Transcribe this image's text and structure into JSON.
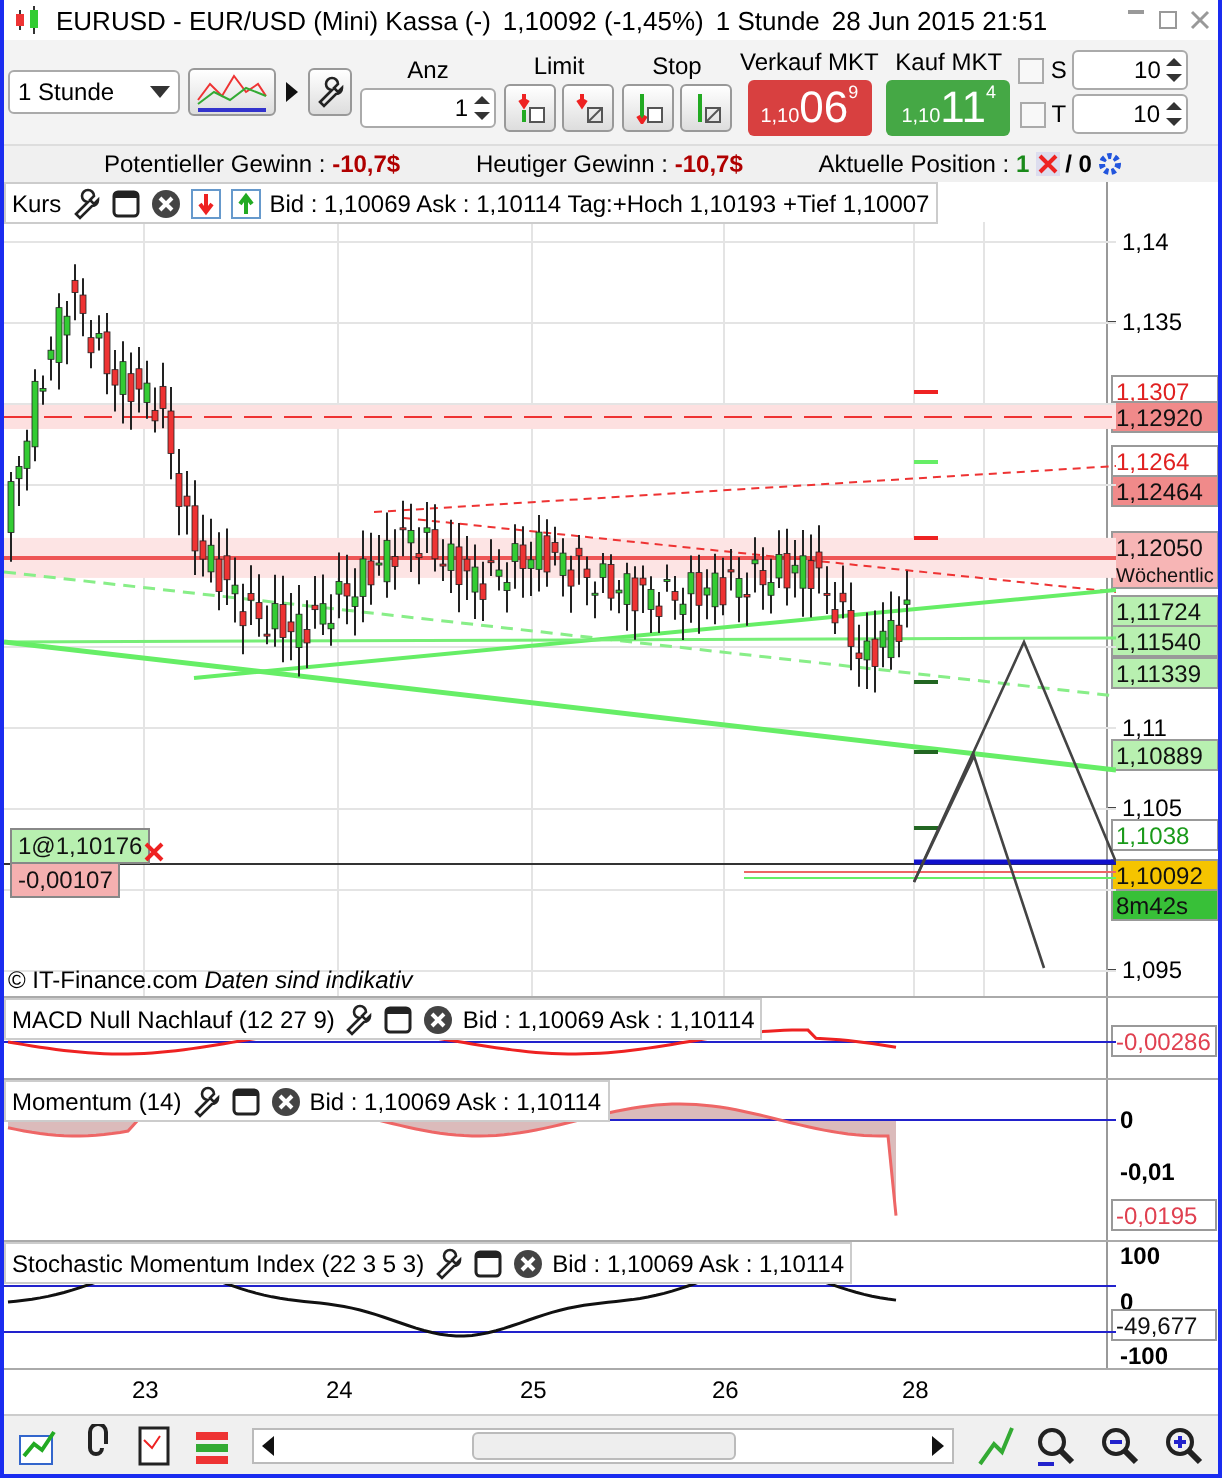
{
  "window": {
    "symbol": "EURUSD - EUR/USD (Mini) Kassa (-)",
    "quote": "1,10092 (-1,45%)",
    "interval": "1 Stunde",
    "datetime": "28 Jun 2015 21:51"
  },
  "toolbar": {
    "timeframe": "1 Stunde",
    "amount": {
      "label": "Anz",
      "value": "1"
    },
    "limit_label": "Limit",
    "stop_label": "Stop",
    "sell": {
      "label": "Verkauf MKT",
      "prefix": "1,10",
      "big": "06",
      "sup": "9"
    },
    "buy": {
      "label": "Kauf MKT",
      "prefix": "1,10",
      "big": "11",
      "sup": "4"
    },
    "stops": [
      {
        "label": "S",
        "checked": false,
        "value": "10"
      },
      {
        "label": "T",
        "checked": false,
        "value": "10"
      }
    ]
  },
  "info": {
    "items": [
      {
        "label": "Potentieller Gewinn :",
        "value": "-10,7$"
      },
      {
        "label": "Heutiger Gewinn :",
        "value": "-10,7$"
      }
    ],
    "position": {
      "label": "Aktuelle Position :",
      "count": "1",
      "rest": "/ 0"
    }
  },
  "main_chart": {
    "title": "Kurs",
    "quote": "Bid : 1,10069 Ask : 1,10114 Tag:+Hoch 1,10193 +Tief 1,10007",
    "yticks": [
      "1,14",
      "1,135",
      "1,11",
      "1,105",
      "1,095"
    ],
    "price_tags": [
      {
        "text": "1,1307",
        "kind": "outline-red"
      },
      {
        "text": "1,12920",
        "kind": "fill-red"
      },
      {
        "text": "1,1264",
        "kind": "outline-red"
      },
      {
        "text": "1,12464",
        "kind": "fill-red"
      },
      {
        "text": "1,12050",
        "note": "Wöchentlic",
        "kind": "weekly"
      },
      {
        "text": "1,11724",
        "kind": "fill-green"
      },
      {
        "text": "1,11540",
        "kind": "fill-green"
      },
      {
        "text": "1,11339",
        "kind": "fill-green"
      },
      {
        "text": "1,10889",
        "kind": "fill-green"
      },
      {
        "text": "1,1038",
        "kind": "outline-green"
      },
      {
        "text": "1,10092",
        "kind": "current"
      },
      {
        "text": "8m42s",
        "kind": "timer"
      }
    ],
    "position_tag": "1@1,10176",
    "pl_tag": "-0,00107",
    "footer": "© IT-Finance.com",
    "footer_note": "Daten sind indikativ"
  },
  "indicators": [
    {
      "kind": "macd",
      "title": "MACD Null Nachlauf (12 27 9)",
      "quote": "Bid : 1,10069 Ask : 1,10114",
      "tag": "-0,00286"
    },
    {
      "kind": "momentum",
      "title": "Momentum (14)",
      "quote": "Bid : 1,10069 Ask : 1,10114",
      "yticks": [
        "0",
        "-0,01"
      ],
      "tag": "-0,0195"
    },
    {
      "kind": "stochastic",
      "title": "Stochastic Momentum Index (22 3 5 3)",
      "quote": "Bid : 1,10069 Ask : 1,10114",
      "yticks": [
        "100",
        "0",
        "-100"
      ],
      "tag": "-49,677"
    }
  ],
  "xaxis": [
    "23",
    "24",
    "25",
    "26",
    "28"
  ]
}
